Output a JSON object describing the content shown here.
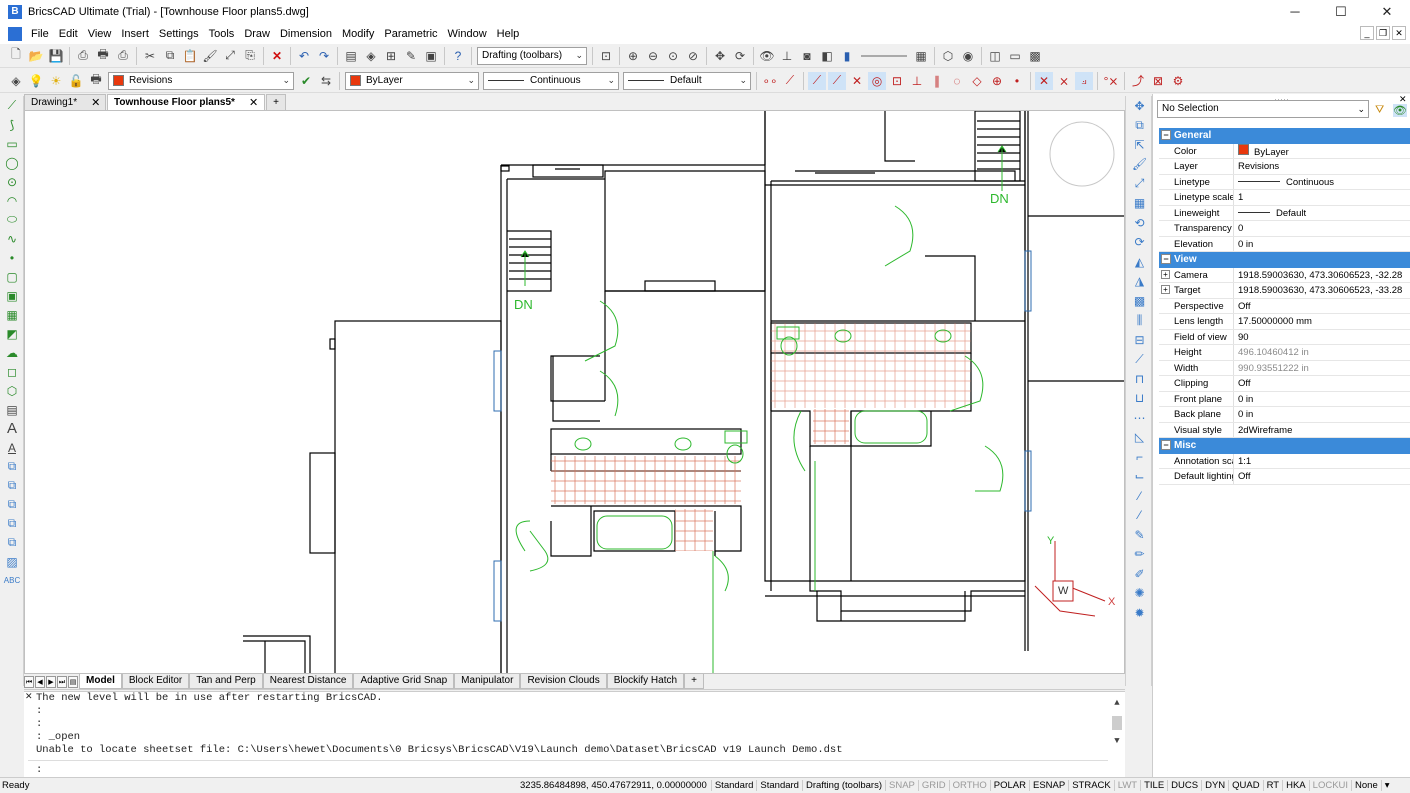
{
  "window": {
    "title": "BricsCAD Ultimate (Trial) - [Townhouse Floor plans5.dwg]",
    "minimize": "─",
    "maximize": "☐",
    "close": "✕"
  },
  "menu": [
    "File",
    "Edit",
    "View",
    "Insert",
    "Settings",
    "Tools",
    "Draw",
    "Dimension",
    "Modify",
    "Parametric",
    "Window",
    "Help"
  ],
  "toolbar1": {
    "workspace_combo": "Drafting (toolbars)"
  },
  "toolbar2": {
    "layer_combo": "Revisions",
    "color_combo": "ByLayer",
    "linetype_combo": "Continuous",
    "lineweight_combo": "Default"
  },
  "doc_tabs": [
    {
      "label": "Drawing1*",
      "active": false
    },
    {
      "label": "Townhouse Floor plans5*",
      "active": true
    }
  ],
  "doc_tab_add": "+",
  "drawing": {
    "dn_label_1": "DN",
    "dn_label_2": "DN",
    "ucs_y": "Y",
    "ucs_x": "X",
    "ucs_w": "W"
  },
  "layout_tabs": [
    "Model",
    "Block Editor",
    "Tan and Perp",
    "Nearest Distance",
    "Adaptive Grid Snap",
    "Manipulator",
    "Revision Clouds",
    "Blockify Hatch"
  ],
  "layout_tab_add": "+",
  "command_line": {
    "history": [
      "The new level will be in use after restarting BricsCAD.",
      ":",
      ":",
      ": _open",
      "Unable to locate sheetset file: C:\\Users\\hewet\\Documents\\0 Bricsys\\BricsCAD\\V19\\Launch demo\\Dataset\\BricsCAD v19 Launch Demo.dst"
    ],
    "prompt": ":"
  },
  "properties": {
    "selection": "No Selection",
    "sections": [
      {
        "name": "General",
        "rows": [
          {
            "key": "Color",
            "value": "ByLayer",
            "swatch": "#e8380d"
          },
          {
            "key": "Layer",
            "value": "Revisions"
          },
          {
            "key": "Linetype",
            "value": "Continuous",
            "line": true
          },
          {
            "key": "Linetype scale",
            "value": "1"
          },
          {
            "key": "Lineweight",
            "value": "Default",
            "line": true
          },
          {
            "key": "Transparency",
            "value": "0"
          },
          {
            "key": "Elevation",
            "value": "0 in"
          }
        ]
      },
      {
        "name": "View",
        "rows": [
          {
            "key": "Camera",
            "value": "1918.59003630, 473.30606523, -32.28",
            "expand": true
          },
          {
            "key": "Target",
            "value": "1918.59003630, 473.30606523, -33.28",
            "expand": true
          },
          {
            "key": "Perspective",
            "value": "Off"
          },
          {
            "key": "Lens length",
            "value": "17.50000000 mm"
          },
          {
            "key": "Field of view",
            "value": "90"
          },
          {
            "key": "Height",
            "value": "496.10460412 in",
            "gray": true
          },
          {
            "key": "Width",
            "value": "990.93551222 in",
            "gray": true
          },
          {
            "key": "Clipping",
            "value": "Off"
          },
          {
            "key": "Front plane",
            "value": "0 in"
          },
          {
            "key": "Back plane",
            "value": "0 in"
          },
          {
            "key": "Visual style",
            "value": "2dWireframe"
          }
        ]
      },
      {
        "name": "Misc",
        "rows": [
          {
            "key": "Annotation scale",
            "value": "1:1"
          },
          {
            "key": "Default lighting",
            "value": "Off"
          }
        ]
      }
    ]
  },
  "status": {
    "ready": "Ready",
    "coords": "3235.86484898, 450.47672911, 0.00000000",
    "items": [
      {
        "label": "Standard",
        "on": true
      },
      {
        "label": "Standard",
        "on": true
      },
      {
        "label": "Drafting (toolbars)",
        "on": true
      },
      {
        "label": "SNAP",
        "on": false
      },
      {
        "label": "GRID",
        "on": false
      },
      {
        "label": "ORTHO",
        "on": false
      },
      {
        "label": "POLAR",
        "on": true
      },
      {
        "label": "ESNAP",
        "on": true
      },
      {
        "label": "STRACK",
        "on": true
      },
      {
        "label": "LWT",
        "on": false
      },
      {
        "label": "TILE",
        "on": true
      },
      {
        "label": "DUCS",
        "on": true
      },
      {
        "label": "DYN",
        "on": true
      },
      {
        "label": "QUAD",
        "on": true
      },
      {
        "label": "RT",
        "on": true
      },
      {
        "label": "HKA",
        "on": true
      },
      {
        "label": "LOCKUI",
        "on": false
      },
      {
        "label": "None",
        "on": true
      }
    ]
  },
  "colors": {
    "accent": "#3b8ad9",
    "layer_red": "#e8380d",
    "wall": "#000000",
    "fixture_green": "#2db82d",
    "tile_red": "#d9735a"
  }
}
